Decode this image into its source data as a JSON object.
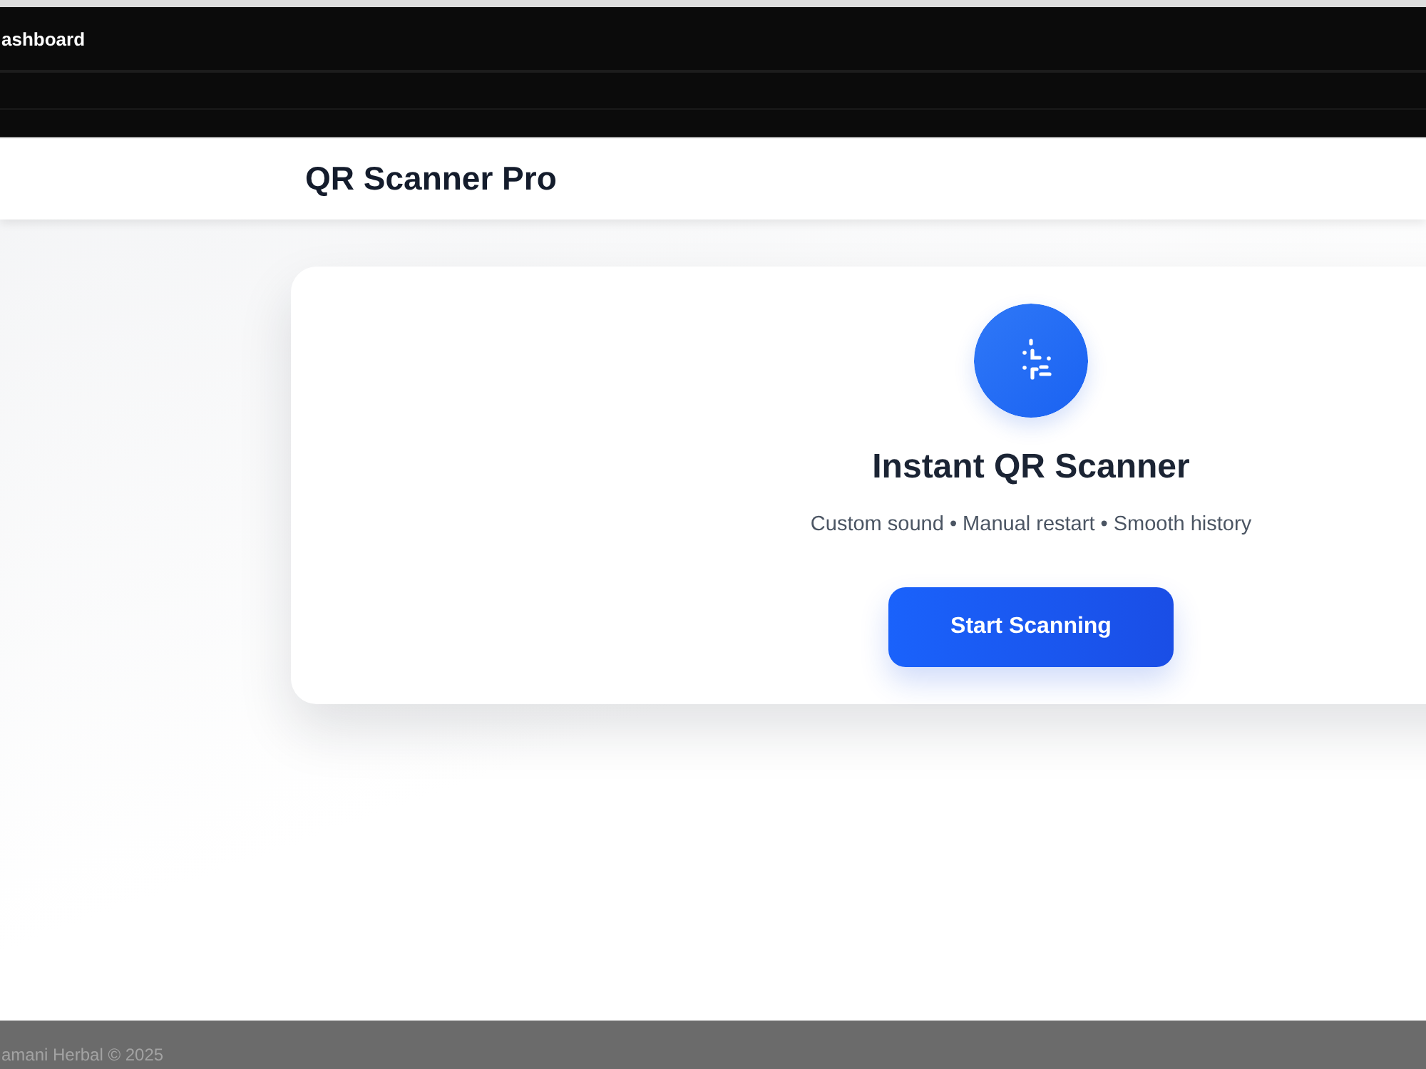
{
  "top_nav": {
    "link": "ashboard"
  },
  "header": {
    "title": "QR Scanner Pro"
  },
  "card": {
    "title": "Instant QR Scanner",
    "subtitle": "Custom sound • Manual restart • Smooth history",
    "button": "Start Scanning"
  },
  "footer": {
    "text": "amani Herbal © 2025"
  }
}
